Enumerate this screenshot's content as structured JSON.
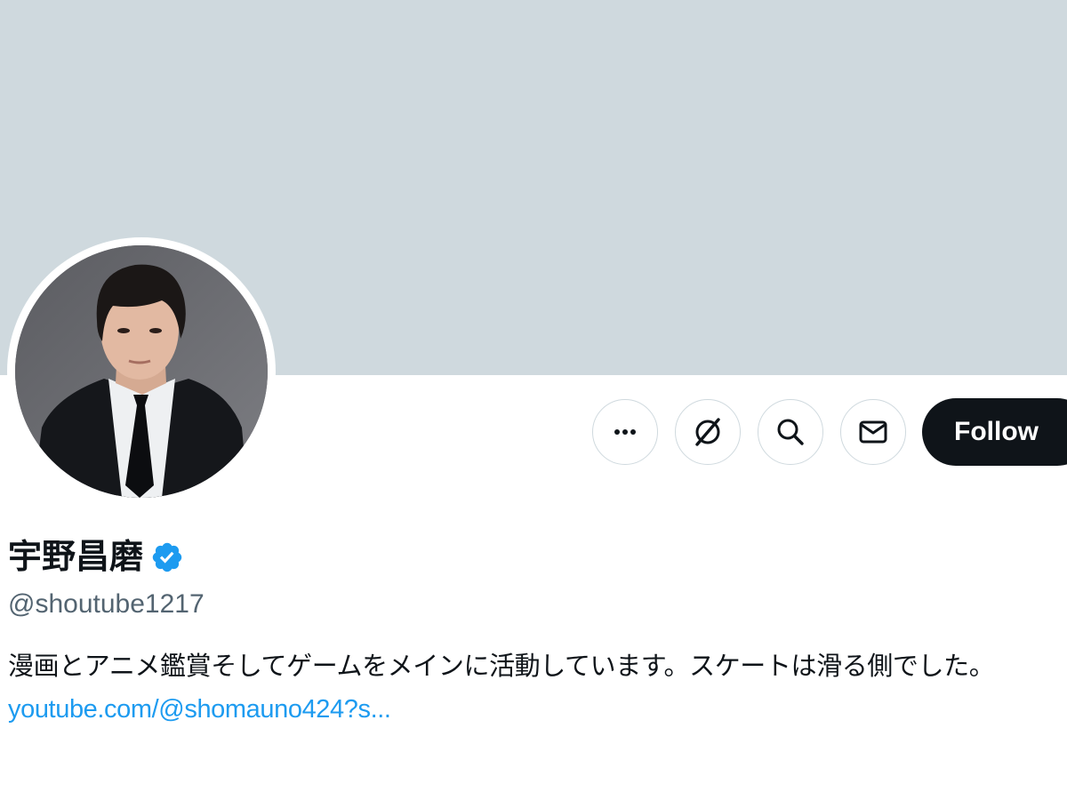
{
  "profile": {
    "display_name": "宇野昌磨",
    "handle": "@shoutube1217",
    "verified": true,
    "bio_text": "漫画とアニメ鑑賞そしてゲームをメインに活動しています。スケートは滑る側でした。",
    "bio_link": "youtube.com/@shomauno424?s..."
  },
  "actions": {
    "more_icon": "more-horizontal-icon",
    "grok_icon": "grok-icon",
    "search_icon": "search-icon",
    "message_icon": "envelope-icon",
    "follow_label": "Follow"
  },
  "colors": {
    "banner": "#cfd9de",
    "accent": "#1d9bf0",
    "follow_bg": "#0f1419",
    "text": "#0f1419",
    "muted": "#536471"
  }
}
